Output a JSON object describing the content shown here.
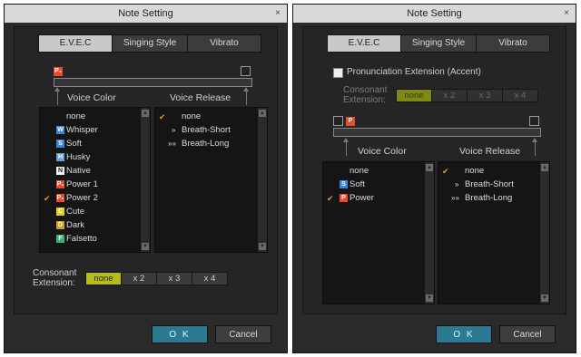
{
  "icons": {
    "close": "close-icon",
    "check": "checkmark-icon",
    "scroll_up": "scroll-up-icon",
    "scroll_down": "scroll-down-icon"
  },
  "colors": {
    "ok_button": "#2c7a92",
    "segment_selected": "#b6bd1b",
    "check": "#e0a020",
    "power": "#e84a2c"
  },
  "left": {
    "title": "Note Setting",
    "close": "×",
    "tabs": [
      "E.V.E.C",
      "Singing Style",
      "Vibrato"
    ],
    "active_tab": "E.V.E.C",
    "swatch_label": "P₂",
    "voice_color_header": "Voice Color",
    "voice_release_header": "Voice Release",
    "voice_colors": [
      {
        "icon": "",
        "label": "none",
        "color": ""
      },
      {
        "icon": "W",
        "label": "Whisper",
        "color": "#3a86d8"
      },
      {
        "icon": "S",
        "label": "Soft",
        "color": "#3a86d8"
      },
      {
        "icon": "H",
        "label": "Husky",
        "color": "#6aa0d8"
      },
      {
        "icon": "N",
        "label": "Native",
        "color": "#f2f2f2"
      },
      {
        "icon": "P₁",
        "label": "Power 1",
        "color": "#e84a2c"
      },
      {
        "icon": "P₂",
        "label": "Power 2",
        "color": "#e84a2c"
      },
      {
        "icon": "C",
        "label": "Cute",
        "color": "#e6cf1a"
      },
      {
        "icon": "D",
        "label": "Dark",
        "color": "#c9a21a"
      },
      {
        "icon": "F",
        "label": "Falsetto",
        "color": "#3bb07a"
      }
    ],
    "voice_color_selected": "Power 2",
    "voice_releases": [
      {
        "mark": "",
        "label": "none"
      },
      {
        "mark": "»",
        "label": "Breath-Short"
      },
      {
        "mark": "»»",
        "label": "Breath-Long"
      }
    ],
    "voice_release_selected": "none",
    "consonant_label_1": "Consonant",
    "consonant_label_2": "Extension:",
    "consonant_options": [
      "none",
      "x 2",
      "x 3",
      "x 4"
    ],
    "consonant_selected": "none",
    "ok": "O K",
    "cancel": "Cancel"
  },
  "right": {
    "title": "Note Setting",
    "close": "×",
    "tabs": [
      "E.V.E.C",
      "Singing Style",
      "Vibrato"
    ],
    "active_tab": "E.V.E.C",
    "pronunciation_label": "Pronunciation Extension (Accent)",
    "pronunciation_checked": false,
    "consonant_label_1": "Consonant",
    "consonant_label_2": "Extension:",
    "consonant_options": [
      "none",
      "x 2",
      "x 3",
      "x 4"
    ],
    "consonant_selected": "none",
    "swatch_label": "P",
    "voice_color_header": "Voice Color",
    "voice_release_header": "Voice Release",
    "voice_colors": [
      {
        "icon": "",
        "label": "none",
        "color": ""
      },
      {
        "icon": "S",
        "label": "Soft",
        "color": "#3a86d8"
      },
      {
        "icon": "P",
        "label": "Power",
        "color": "#e84a2c"
      }
    ],
    "voice_color_selected": "Power",
    "voice_releases": [
      {
        "mark": "",
        "label": "none"
      },
      {
        "mark": "»",
        "label": "Breath-Short"
      },
      {
        "mark": "»»",
        "label": "Breath-Long"
      }
    ],
    "voice_release_selected": "none",
    "ok": "O K",
    "cancel": "Cancel"
  }
}
